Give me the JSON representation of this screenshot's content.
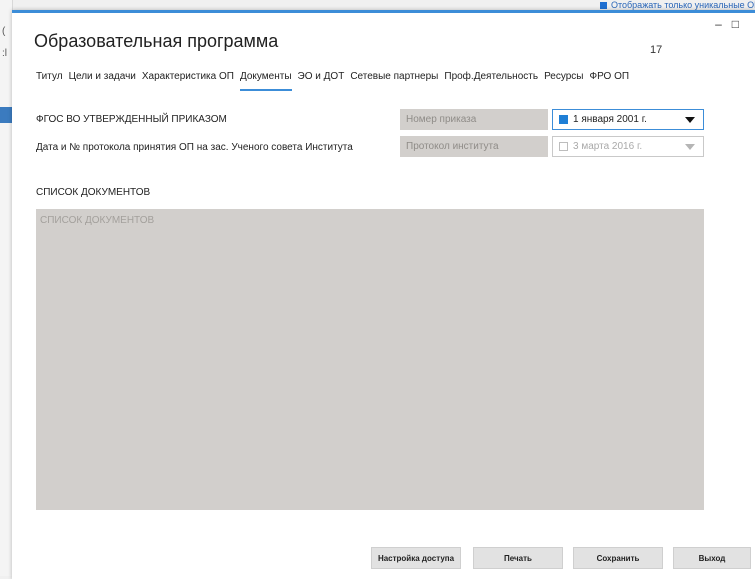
{
  "background": {
    "top_checkbox_label": "Отображать только уникальные ОП"
  },
  "window": {
    "title": "Образовательная программа",
    "counter": "17",
    "minimize_glyph": "–",
    "maximize_glyph": "□"
  },
  "tabs": [
    {
      "label": "Титул"
    },
    {
      "label": "Цели и задачи"
    },
    {
      "label": "Характеристика ОП"
    },
    {
      "label": "Документы",
      "active": true
    },
    {
      "label": "ЭО и ДОТ"
    },
    {
      "label": "Сетевые партнеры"
    },
    {
      "label": "Проф.Деятельность"
    },
    {
      "label": "Ресурсы"
    },
    {
      "label": "ФРО ОП"
    }
  ],
  "form": {
    "fgos": {
      "label": "ФГОС ВО УТВЕРЖДЕННЫЙ ПРИКАЗОМ",
      "order_number_placeholder": "Номер приказа",
      "date": "1 января 2001 г.",
      "date_checked": true
    },
    "protocol": {
      "label": "Дата и № протокола принятия ОП на зас. Ученого совета Института",
      "protocol_placeholder": "Протокол института",
      "date": "3 марта 2016 г.",
      "date_checked": false
    }
  },
  "documents": {
    "heading": "СПИСОК ДОКУМЕНТОВ",
    "placeholder": "СПИСОК ДОКУМЕНТОВ"
  },
  "buttons": {
    "access": "Настройка доступа",
    "print": "Печать",
    "save": "Сохранить",
    "exit": "Выход"
  },
  "colors": {
    "accent": "#3c8dd8",
    "field_bg": "#d2cfcc",
    "checkbox_checked": "#1f7fd6"
  }
}
